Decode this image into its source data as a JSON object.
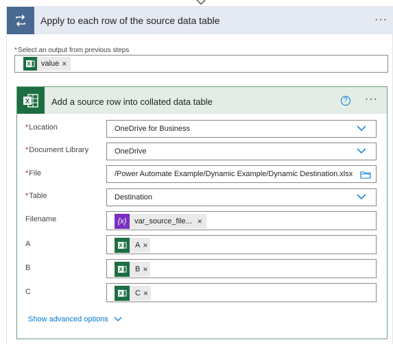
{
  "loop": {
    "title": "Apply to each row of the source data table",
    "more_label": "···",
    "select_label": "Select an output from previous steps",
    "required_mark": "*",
    "output_token": "value",
    "remove_mark": "×"
  },
  "action": {
    "title": "Add a source row into collated data table",
    "help_label": "?",
    "more_label": "···",
    "fields": {
      "location": {
        "label": "Location",
        "value": "OneDrive for Business"
      },
      "library": {
        "label": "Document Library",
        "value": "OneDrive"
      },
      "file": {
        "label": "File",
        "value": "/Power Automate Example/Dynamic Example/Dynamic Destination.xlsx"
      },
      "table": {
        "label": "Table",
        "value": "Destination"
      },
      "filename": {
        "label": "Filename",
        "token": "var_source_file...",
        "token_icon": "{x}"
      },
      "col_a": {
        "label": "A",
        "token": "A"
      },
      "col_b": {
        "label": "B",
        "token": "B"
      },
      "col_c": {
        "label": "C",
        "token": "C"
      }
    },
    "advanced_link": "Show advanced options"
  },
  "colors": {
    "loop_header_bg": "#e5e9f2",
    "loop_icon_bg": "#486991",
    "excel_green": "#1d6f42",
    "action_header_bg": "#e3ede5",
    "variable_purple": "#7a2fc2",
    "link_blue": "#0078d4",
    "required_red": "#a4262c"
  },
  "icons": [
    "down-arrow-icon",
    "loop-icon",
    "excel-icon",
    "help-icon",
    "chevron-down-icon",
    "folder-icon",
    "variable-icon",
    "close-icon"
  ]
}
